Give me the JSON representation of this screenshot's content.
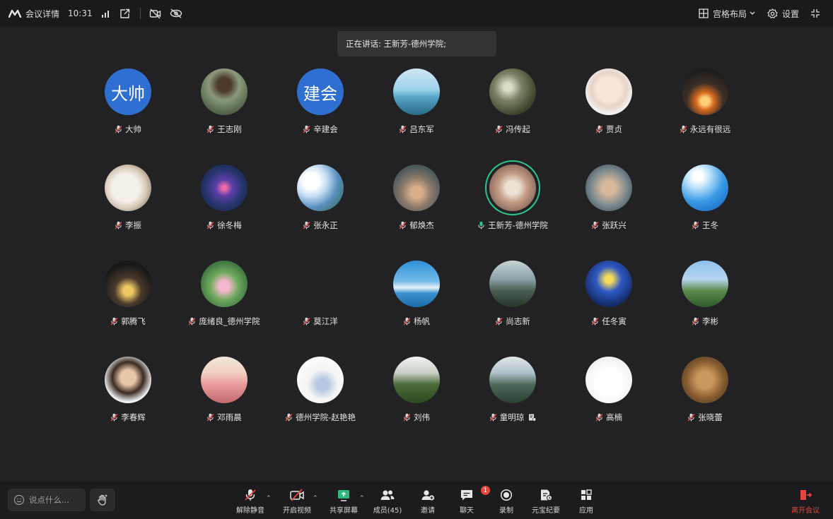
{
  "topbar": {
    "app_title": "会议详情",
    "time": "10:31",
    "layout_label": "宫格布局",
    "settings_label": "设置"
  },
  "speaking": {
    "text": "正在讲话: 王新芳-德州学院;"
  },
  "participants": [
    {
      "name": "大帅",
      "avatar_text": "大帅"
    },
    {
      "name": "王志刚"
    },
    {
      "name": "辛建会",
      "avatar_text": "建会"
    },
    {
      "name": "吕东军"
    },
    {
      "name": "冯传起"
    },
    {
      "name": "贾贞"
    },
    {
      "name": "永远有很远"
    },
    {
      "name": "李振"
    },
    {
      "name": "徐冬梅"
    },
    {
      "name": "张永正"
    },
    {
      "name": "郁焕杰"
    },
    {
      "name": "王新芳-德州学院"
    },
    {
      "name": "张跃兴"
    },
    {
      "name": "王冬"
    },
    {
      "name": "郭腾飞"
    },
    {
      "name": "庞绪良_德州学院"
    },
    {
      "name": "莫江洋"
    },
    {
      "name": "杨帆"
    },
    {
      "name": "尚志新"
    },
    {
      "name": "任冬寅"
    },
    {
      "name": "李彬"
    },
    {
      "name": "李春辉"
    },
    {
      "name": "邓雨晨"
    },
    {
      "name": "德州学院-赵艳艳"
    },
    {
      "name": "刘伟"
    },
    {
      "name": "童明琼"
    },
    {
      "name": "高楠"
    },
    {
      "name": "张晓蕾"
    }
  ],
  "bottombar": {
    "chat_placeholder": "说点什么...",
    "unmute": "解除静音",
    "start_video": "开启视频",
    "share_screen": "共享屏幕",
    "members": "成员(45)",
    "invite": "邀请",
    "chat": "聊天",
    "chat_badge": "1",
    "record": "录制",
    "minutes": "元宝纪要",
    "apps": "应用",
    "leave": "离开会议"
  },
  "colors": {
    "accent_red": "#e8453c",
    "speaking_ring": "#2cc98a",
    "avatar_blue": "#2f6fd1"
  }
}
